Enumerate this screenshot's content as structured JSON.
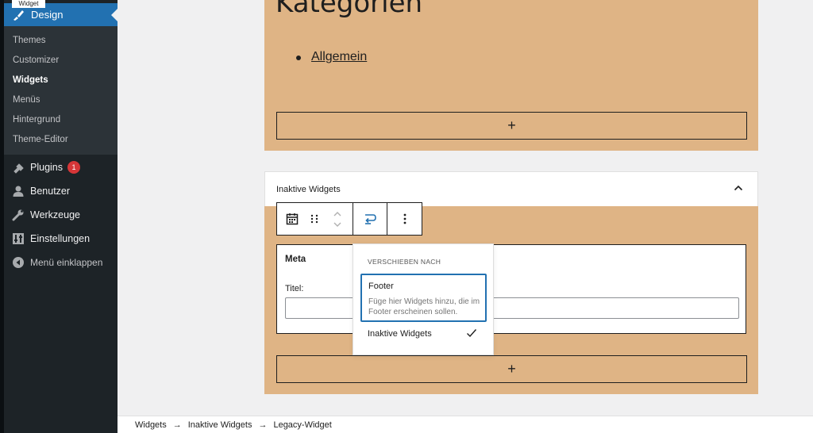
{
  "sidebar": {
    "tooltip": "Widget",
    "active": {
      "label": "Design",
      "icon": "paintbrush-icon"
    },
    "submenu": [
      "Themes",
      "Customizer",
      "Widgets",
      "Menüs",
      "Hintergrund",
      "Theme-Editor"
    ],
    "current_submenu": "Widgets",
    "items": [
      {
        "label": "Plugins",
        "icon": "plugin-icon",
        "badge": "1"
      },
      {
        "label": "Benutzer",
        "icon": "user-icon"
      },
      {
        "label": "Werkzeuge",
        "icon": "wrench-icon"
      },
      {
        "label": "Einstellungen",
        "icon": "settings-icon"
      }
    ],
    "collapse_label": "Menü einklappen"
  },
  "editor": {
    "heading": "Kategorien",
    "category_link": "Allgemein",
    "add_symbol": "+",
    "area_title": "Inaktive Widgets",
    "widget": {
      "title": "Meta",
      "field_label": "Titel:",
      "field_value": ""
    }
  },
  "toolbar": {
    "icons": [
      "calendar-icon",
      "drag-handle-icon",
      "move-up-icon",
      "move-down-icon",
      "move-to-icon",
      "more-options-icon"
    ]
  },
  "move_menu": {
    "heading": "VERSCHIEBEN NACH",
    "option_title": "Footer",
    "option_desc": "Füge hier Widgets hinzu, die im Footer erscheinen sollen.",
    "item": "Inaktive Widgets"
  },
  "breadcrumb": [
    "Widgets",
    "Inaktive Widgets",
    "Legacy-Widget"
  ],
  "breadcrumb_sep": "→",
  "colors": {
    "sidebar": "#1d2327",
    "accent": "#2271b1",
    "area_bg": "#dfb485",
    "badge": "#d63638"
  }
}
